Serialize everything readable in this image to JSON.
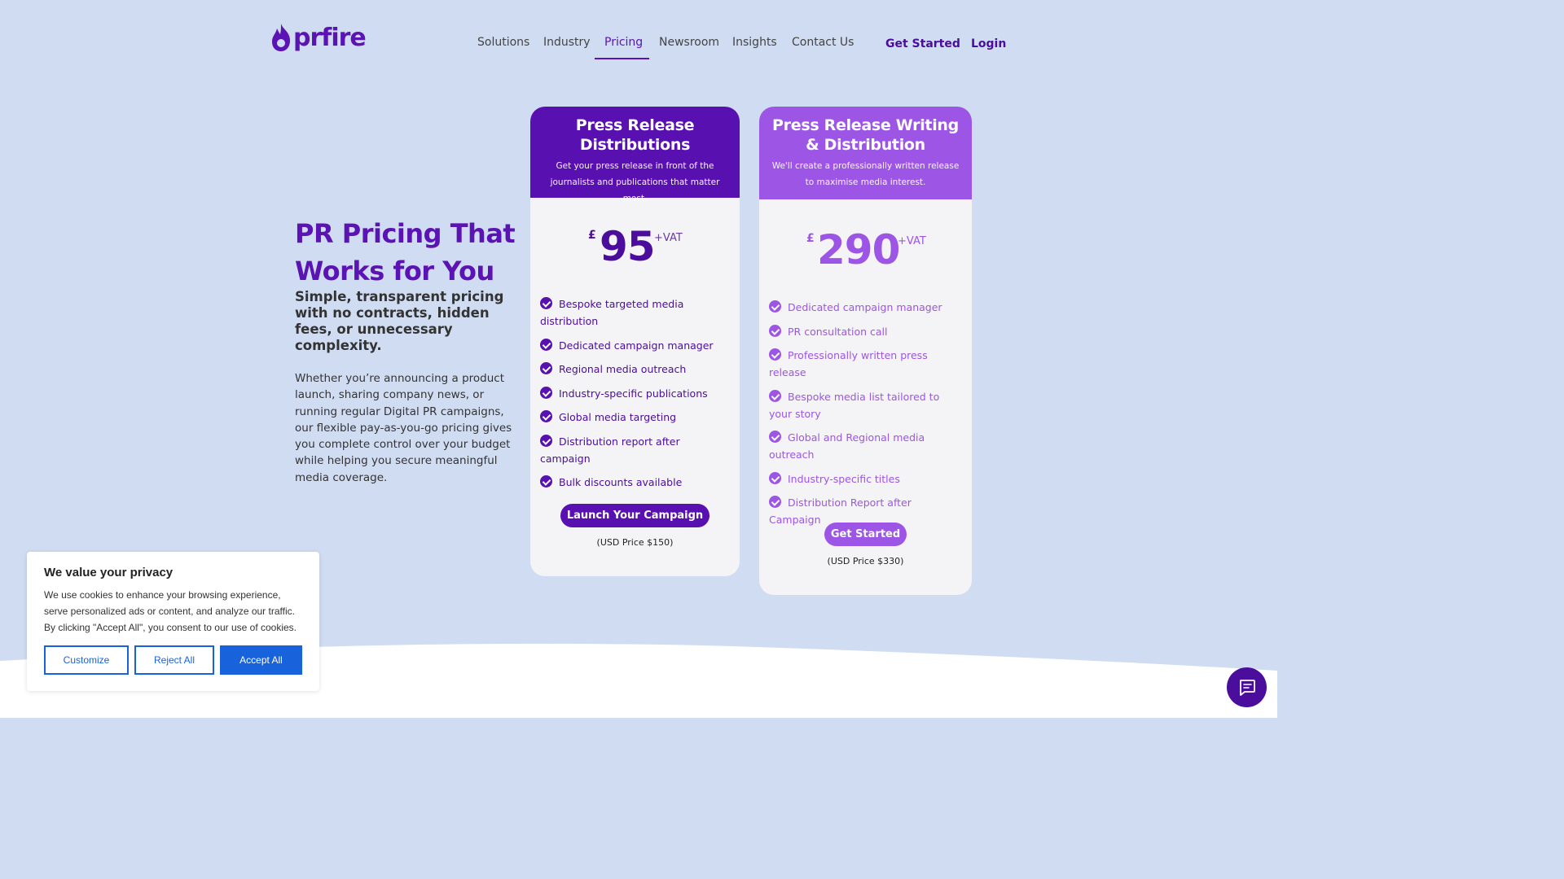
{
  "brand": {
    "name": "prfire",
    "color": "#5b13b3"
  },
  "nav": {
    "items": [
      {
        "label": "Solutions"
      },
      {
        "label": "Industry"
      },
      {
        "label": "Pricing",
        "active": true
      },
      {
        "label": "Newsroom"
      },
      {
        "label": "Insights"
      },
      {
        "label": "Contact Us"
      }
    ],
    "get_started": "Get Started",
    "login": "Login"
  },
  "hero": {
    "title": "PR Pricing That Works for You",
    "subtitle": "Simple, transparent pricing with no contracts, hidden fees, or unnecessary complexity.",
    "body": "Whether you’re announcing a product launch, sharing company news, or running regular Digital PR campaigns, our flexible pay-as-you-go pricing gives you complete control over your budget while helping you secure meaningful media coverage."
  },
  "plans": [
    {
      "title": "Press Release Distributions",
      "description": "Get your press release in front of the journalists and publications that matter most.",
      "currency": "£",
      "price": "95",
      "vat": "+VAT",
      "features": [
        "Bespoke targeted media distribution",
        "Dedicated campaign manager",
        "Regional media outreach",
        "Industry-specific publications",
        "Global media targeting",
        "Distribution report after campaign",
        "Bulk discounts available"
      ],
      "cta": "Launch Your Campaign",
      "usd_price": "(USD Price $150)",
      "color": "#5910b0"
    },
    {
      "title": "Press Release Writing & Distribution",
      "description": "We'll create a professionally written release to maximise media interest.",
      "currency": "£",
      "price": "290",
      "vat": "+VAT",
      "features": [
        "Dedicated campaign manager",
        "PR consultation call",
        "Professionally written press release",
        "Bespoke media list tailored to your story",
        "Global and Regional media outreach",
        "Industry-specific titles",
        "Distribution Report after Campaign"
      ],
      "cta": "Get Started",
      "usd_price": "(USD Price $330)",
      "color": "#9c55e4"
    }
  ],
  "cookie": {
    "title": "We value your privacy",
    "text": "We use cookies to enhance your browsing experience, serve personalized ads or content, and analyze our traffic. By clicking \"Accept All\", you consent to our use of cookies.",
    "customize": "Customize",
    "reject": "Reject All",
    "accept": "Accept All",
    "accent": "#1863dc"
  },
  "chat": {
    "icon": "chat-icon"
  }
}
